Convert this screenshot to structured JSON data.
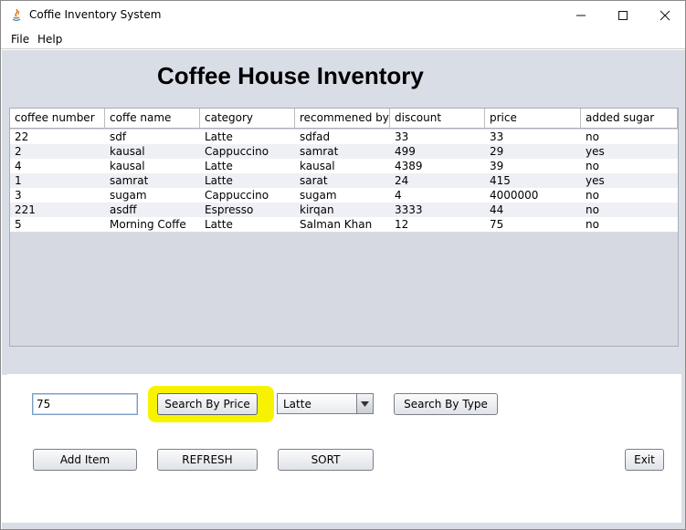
{
  "window": {
    "title": "Coffie Inventory System",
    "colors": {
      "highlight": "#f7f300",
      "panel": "#d9dde5",
      "input_border": "#7a9cc7"
    }
  },
  "menu": {
    "file": "File",
    "help": "Help"
  },
  "heading": "Coffee House Inventory",
  "table": {
    "columns": [
      "coffee number",
      "coffe name",
      "category",
      "recommened by",
      "discount",
      "price",
      "added sugar"
    ],
    "rows": [
      [
        "22",
        "sdf",
        "Latte",
        "sdfad",
        "33",
        "33",
        "no"
      ],
      [
        "2",
        "kausal",
        "Cappuccino",
        "samrat",
        "499",
        "29",
        "yes"
      ],
      [
        "4",
        "kausal",
        "Latte",
        "kausal",
        "4389",
        "39",
        "no"
      ],
      [
        "1",
        "samrat",
        "Latte",
        "sarat",
        "24",
        "415",
        "yes"
      ],
      [
        "3",
        "sugam",
        "Cappuccino",
        "sugam",
        "4",
        "4000000",
        "no"
      ],
      [
        "221",
        "asdff",
        "Espresso",
        "kirqan",
        "3333",
        "44",
        "no"
      ],
      [
        "5",
        "Morning Coffe",
        "Latte",
        "Salman Khan",
        "12",
        "75",
        "no"
      ]
    ]
  },
  "controls": {
    "price_value": "75",
    "search_price": "Search By Price",
    "category_selected": "Latte",
    "search_type": "Search By Type",
    "add_item": "Add Item",
    "refresh": "REFRESH",
    "sort": "SORT",
    "exit": "Exit"
  },
  "icons": [
    "java-app-icon",
    "minimize-icon",
    "maximize-icon",
    "close-icon",
    "dropdown-arrow-icon"
  ]
}
